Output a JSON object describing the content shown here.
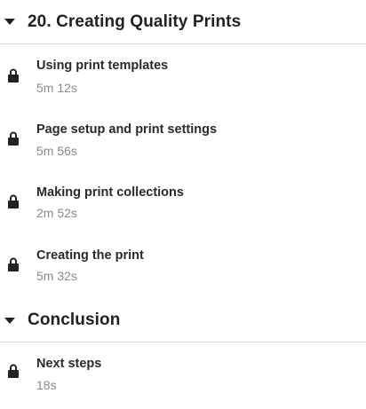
{
  "sections": [
    {
      "title": "20. Creating Quality Prints",
      "lessons": [
        {
          "title": "Using print templates",
          "duration": "5m 12s"
        },
        {
          "title": "Page setup and print settings",
          "duration": "5m 56s"
        },
        {
          "title": "Making print collections",
          "duration": "2m 52s"
        },
        {
          "title": "Creating the print",
          "duration": "5m 32s"
        }
      ]
    },
    {
      "title": "Conclusion",
      "lessons": [
        {
          "title": "Next steps",
          "duration": "18s"
        }
      ]
    }
  ],
  "icons": {
    "section_toggle": "caret-down-icon",
    "lesson_status": "lock-icon"
  },
  "colors": {
    "text": "#222222",
    "secondary_text": "#8a8a8a",
    "divider": "#dddddd"
  }
}
